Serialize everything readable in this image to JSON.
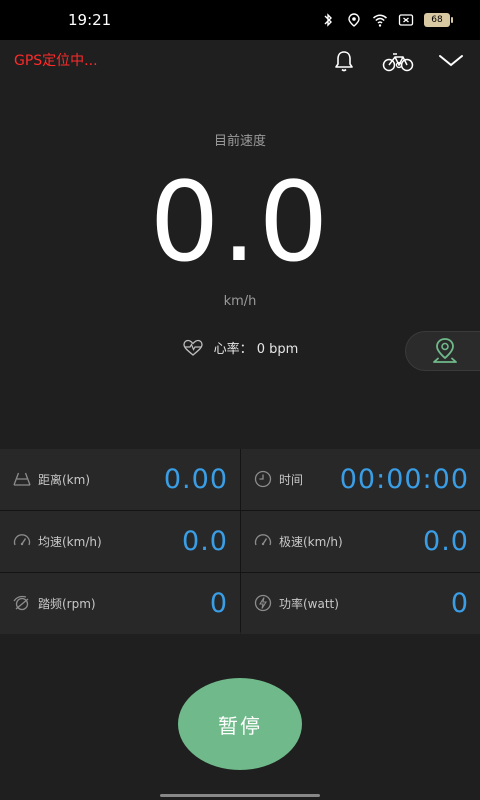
{
  "status_bar": {
    "time": "19:21",
    "battery": "68"
  },
  "header": {
    "gps_status": "GPS定位中..."
  },
  "speed": {
    "label": "目前速度",
    "value": "0.0",
    "unit": "km/h"
  },
  "heart_rate": {
    "text": "心率：  0 bpm"
  },
  "metrics": [
    {
      "icon": "road-icon",
      "label": "距离(km)",
      "value": "0.00"
    },
    {
      "icon": "clock-icon",
      "label": "时间",
      "value": "00:00:00"
    },
    {
      "icon": "speedometer-icon",
      "label": "均速(km/h)",
      "value": "0.0"
    },
    {
      "icon": "speedometer-icon",
      "label": "极速(km/h)",
      "value": "0.0"
    },
    {
      "icon": "cadence-icon",
      "label": "踏频(rpm)",
      "value": "0"
    },
    {
      "icon": "power-icon",
      "label": "功率(watt)",
      "value": "0"
    }
  ],
  "pause_button": {
    "label": "暂停"
  },
  "colors": {
    "accent": "#3a9ee6",
    "pause": "#6fb98a",
    "gps_warning": "#ff2a2a",
    "map_pin": "#6fb98a"
  }
}
